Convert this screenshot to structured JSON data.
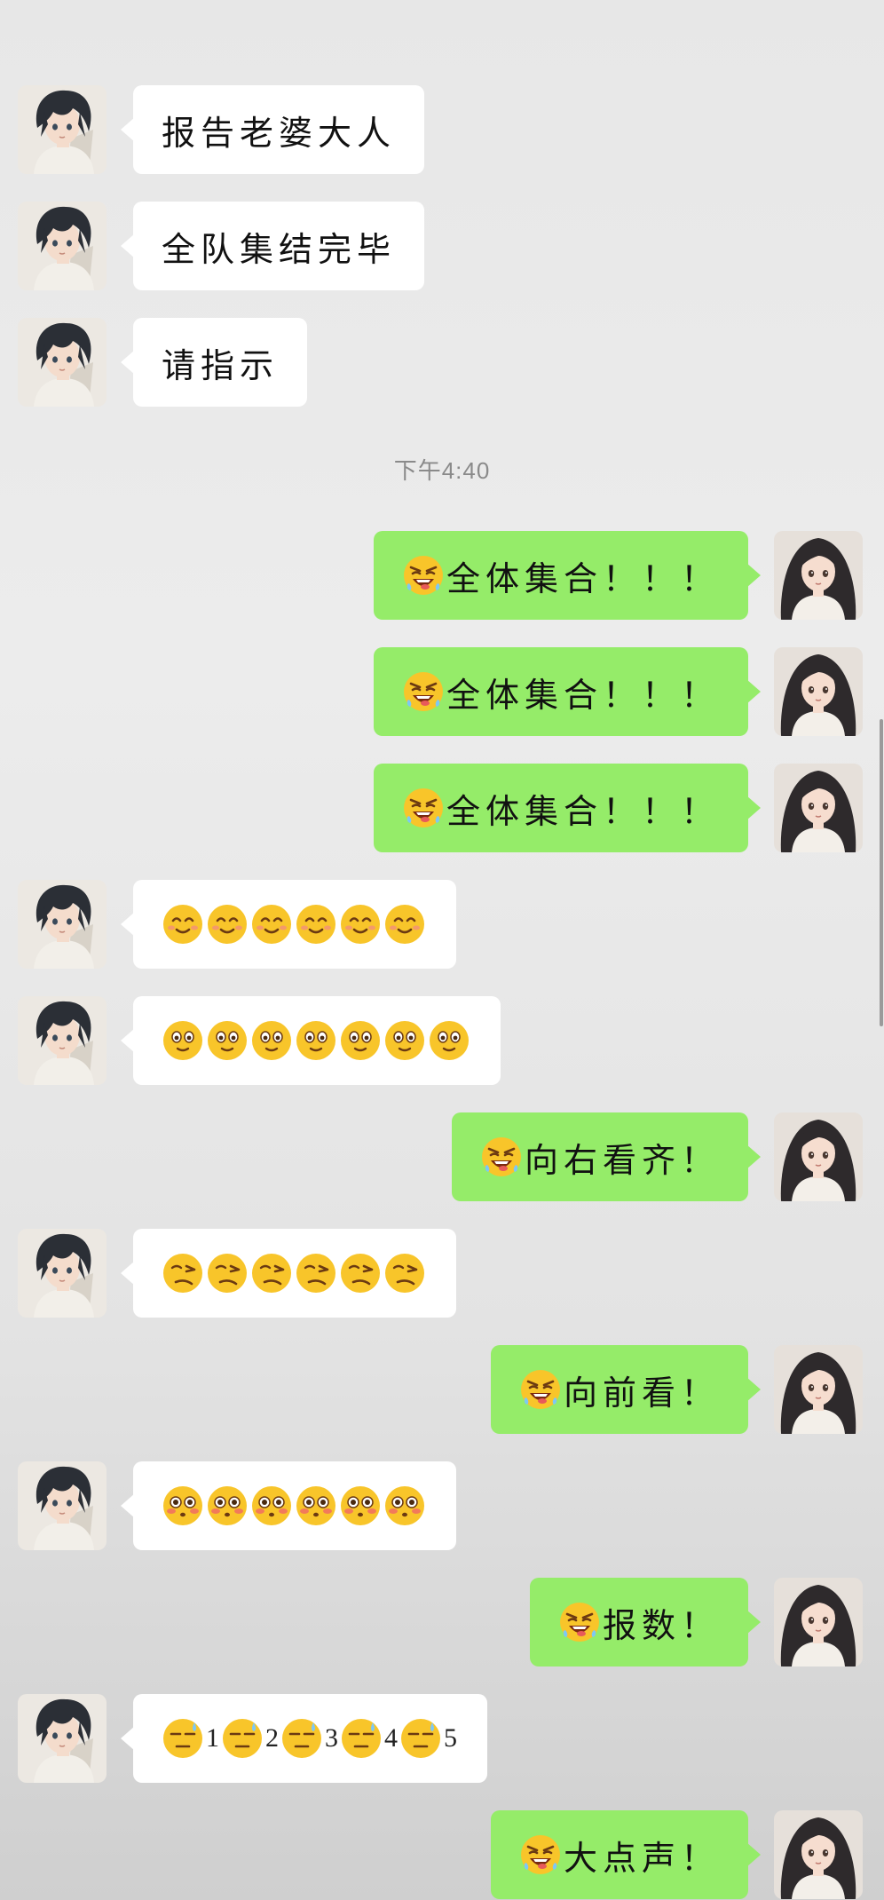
{
  "timestamp": "下午4:40",
  "colors": {
    "outgoing_bubble": "#95ec69",
    "incoming_bubble": "#ffffff",
    "background": "#ececec"
  },
  "messages": [
    {
      "side": "in",
      "text": "报告老婆大人"
    },
    {
      "side": "in",
      "text": "全队集结完毕"
    },
    {
      "side": "in",
      "text": "请指示"
    },
    {
      "side": "out",
      "emoji": "mischievous-grin-emoji",
      "text": "全体集合！！！"
    },
    {
      "side": "out",
      "emoji": "mischievous-grin-emoji",
      "text": "全体集合！！！"
    },
    {
      "side": "out",
      "emoji": "mischievous-grin-emoji",
      "text": "全体集合！！！"
    },
    {
      "side": "in",
      "emoji_seq": [
        "smile-emoji",
        "smile-emoji",
        "smile-emoji",
        "smile-emoji",
        "smile-emoji",
        "smile-emoji"
      ]
    },
    {
      "side": "in",
      "emoji_seq": [
        "wide-eyed-emoji",
        "wide-eyed-emoji",
        "wide-eyed-emoji",
        "wide-eyed-emoji",
        "wide-eyed-emoji",
        "wide-eyed-emoji",
        "wide-eyed-emoji"
      ]
    },
    {
      "side": "out",
      "emoji": "mischievous-grin-emoji",
      "text": "向右看齐！"
    },
    {
      "side": "in",
      "emoji_seq": [
        "side-glance-emoji",
        "side-glance-emoji",
        "side-glance-emoji",
        "side-glance-emoji",
        "side-glance-emoji",
        "side-glance-emoji"
      ]
    },
    {
      "side": "out",
      "emoji": "mischievous-grin-emoji",
      "text": "向前看！"
    },
    {
      "side": "in",
      "emoji_seq": [
        "flushed-emoji",
        "flushed-emoji",
        "flushed-emoji",
        "flushed-emoji",
        "flushed-emoji",
        "flushed-emoji"
      ]
    },
    {
      "side": "out",
      "emoji": "mischievous-grin-emoji",
      "text": "报数！"
    },
    {
      "side": "in",
      "counting": [
        "1",
        "2",
        "3",
        "4",
        "5"
      ],
      "emoji": "cold-sweat-emoji"
    },
    {
      "side": "out",
      "emoji": "mischievous-grin-emoji",
      "text": "大点声！"
    }
  ]
}
